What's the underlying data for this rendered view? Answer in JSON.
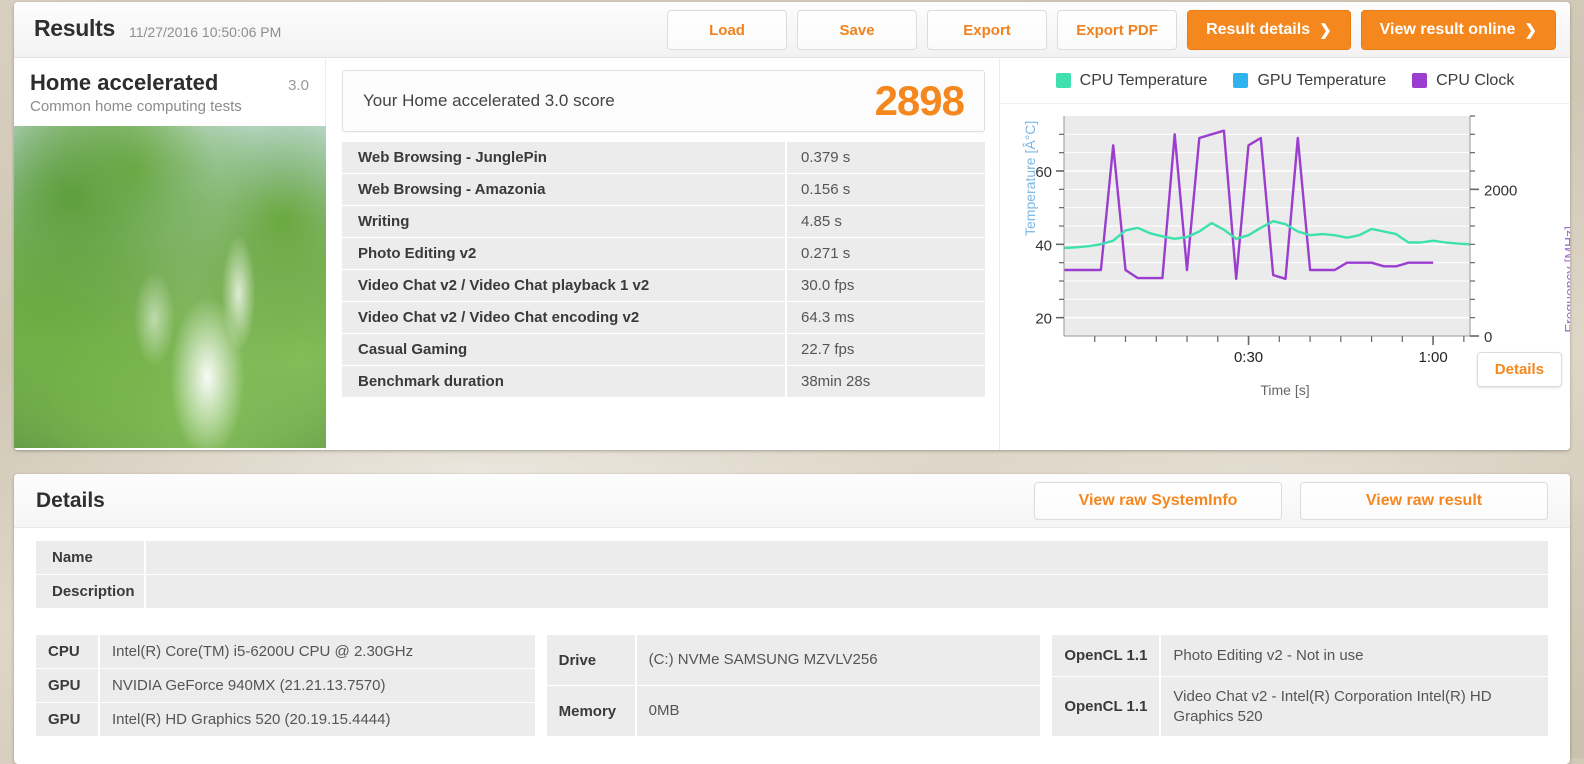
{
  "header": {
    "title": "Results",
    "timestamp": "11/27/2016 10:50:06 PM",
    "buttons": [
      {
        "label": "Load"
      },
      {
        "label": "Save"
      },
      {
        "label": "Export"
      },
      {
        "label": "Export PDF"
      }
    ],
    "primary_buttons": [
      {
        "label": "Result details",
        "chevron": "❯"
      },
      {
        "label": "View result online",
        "chevron": "❯"
      }
    ]
  },
  "benchmark": {
    "name": "Home accelerated",
    "version": "3.0",
    "subtitle": "Common home computing tests",
    "thumbnail_name": "waterfall-jungle-photo"
  },
  "score": {
    "label": "Your Home accelerated 3.0 score",
    "value": "2898",
    "accent_color": "#f5871f"
  },
  "results": {
    "rows": [
      {
        "name": "Web Browsing - JunglePin",
        "value": "0.379 s"
      },
      {
        "name": "Web Browsing - Amazonia",
        "value": "0.156 s"
      },
      {
        "name": "Writing",
        "value": "4.85 s"
      },
      {
        "name": "Photo Editing v2",
        "value": "0.271 s"
      },
      {
        "name": "Video Chat v2 / Video Chat playback 1 v2",
        "value": "30.0 fps"
      },
      {
        "name": "Video Chat v2 / Video Chat encoding v2",
        "value": "64.3 ms"
      },
      {
        "name": "Casual Gaming",
        "value": "22.7 fps"
      },
      {
        "name": "Benchmark duration",
        "value": "38min 28s"
      }
    ]
  },
  "chart_panel": {
    "details_button": "Details"
  },
  "chart_data": {
    "type": "line",
    "title": "",
    "xlabel": "Time [s]",
    "ylabel": "Temperature [Â°C]",
    "y2label": "Frequency [MHz]",
    "xlim": [
      0,
      66
    ],
    "ylim": [
      15,
      75
    ],
    "y2lim": [
      0,
      3000
    ],
    "yticks": [
      20,
      40,
      60
    ],
    "y2ticks": [
      0,
      2000
    ],
    "xticks": [
      "0:30",
      "1:00"
    ],
    "xtick_values": [
      30,
      60
    ],
    "grid": true,
    "legend_position": "top-center",
    "series": [
      {
        "name": "CPU Temperature",
        "color": "#3ee0ad",
        "axis": "left",
        "x": [
          0,
          2,
          4,
          6,
          8,
          10,
          12,
          14,
          16,
          18,
          20,
          22,
          24,
          26,
          28,
          30,
          32,
          34,
          36,
          38,
          40,
          42,
          44,
          46,
          48,
          50,
          52,
          54,
          56,
          58,
          60,
          62,
          64,
          66
        ],
        "values": [
          39,
          39.2,
          39.5,
          40,
          41,
          43.8,
          44.5,
          43,
          42.2,
          41.5,
          42,
          43.5,
          45.8,
          44,
          41.5,
          42.5,
          44.5,
          46.3,
          45.5,
          43.5,
          42.5,
          42.8,
          42.5,
          41.8,
          42.5,
          44.2,
          43.5,
          42.8,
          40.5,
          40.5,
          41,
          40.5,
          40.2,
          40,
          39.5,
          38.2,
          39,
          39.2
        ]
      },
      {
        "name": "GPU Temperature",
        "color": "#2fb4f0",
        "axis": "left",
        "x": [],
        "values": []
      },
      {
        "name": "CPU Clock",
        "color": "#9b3ed0",
        "axis": "right",
        "x": [
          0,
          2,
          4,
          6,
          8,
          10,
          12,
          14,
          16,
          18,
          20,
          22,
          24,
          26,
          28,
          30,
          32,
          34,
          36,
          38,
          40,
          42,
          44,
          46,
          48,
          50,
          52,
          54,
          56,
          58,
          60,
          62,
          64,
          66
        ],
        "values": [
          900,
          900,
          900,
          900,
          2600,
          900,
          790,
          790,
          790,
          2750,
          900,
          2700,
          2750,
          2800,
          780,
          2600,
          2700,
          830,
          780,
          2700,
          900,
          900,
          900,
          1000,
          1000,
          1000,
          950,
          950,
          1000,
          1000,
          1000
        ]
      }
    ]
  },
  "details": {
    "title": "Details",
    "buttons": [
      {
        "label": "View raw SystemInfo"
      },
      {
        "label": "View raw result"
      }
    ],
    "fields": [
      {
        "label": "Name",
        "value": "",
        "placeholder": ""
      },
      {
        "label": "Description",
        "value": "",
        "placeholder": ""
      }
    ],
    "hardware_col1": [
      {
        "key": "CPU",
        "value": "Intel(R) Core(TM) i5-6200U CPU @ 2.30GHz"
      },
      {
        "key": "GPU",
        "value": "NVIDIA GeForce 940MX (21.21.13.7570)"
      },
      {
        "key": "GPU",
        "value": "Intel(R) HD Graphics 520 (20.19.15.4444)"
      }
    ],
    "hardware_col2": [
      {
        "key": "Drive",
        "value": "(C:) NVMe SAMSUNG MZVLV256"
      },
      {
        "key": "Memory",
        "value": "0MB"
      }
    ],
    "hardware_col3": [
      {
        "key": "OpenCL 1.1",
        "value": "Photo Editing v2 - Not in use"
      },
      {
        "key": "OpenCL 1.1",
        "value": "Video Chat v2 - Intel(R) Corporation Intel(R) HD Graphics 520"
      }
    ]
  }
}
